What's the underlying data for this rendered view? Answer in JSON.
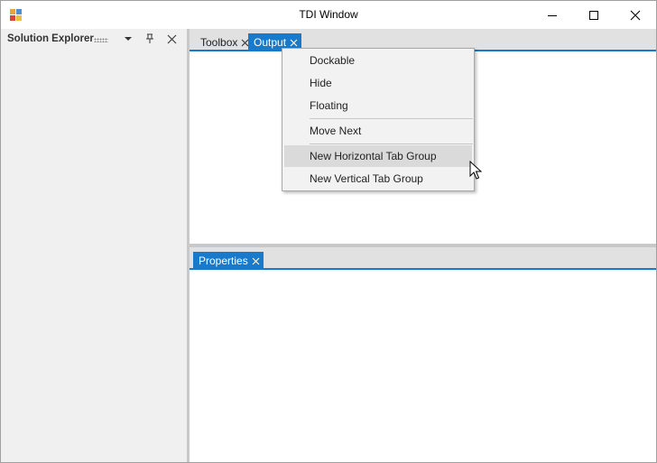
{
  "window": {
    "title": "TDI Window",
    "accent_color": "#1979ca"
  },
  "title_buttons": {
    "minimize_icon": "minimize-icon",
    "maximize_icon": "maximize-icon",
    "close_icon": "close-icon"
  },
  "solution_explorer": {
    "title": "Solution Explorer",
    "icons": [
      "dropdown-arrow-icon",
      "pin-icon",
      "close-icon"
    ]
  },
  "top_tabs": [
    {
      "label": "Toolbox",
      "active": false
    },
    {
      "label": "Output",
      "active": true
    }
  ],
  "bottom_tabs": [
    {
      "label": "Properties",
      "active": true
    }
  ],
  "context_menu": {
    "items": [
      {
        "label": "Dockable"
      },
      {
        "label": "Hide"
      },
      {
        "label": "Floating"
      },
      {
        "label": "Move Next"
      },
      {
        "label": "New Horizontal Tab Group",
        "hovered": true
      },
      {
        "label": "New Vertical Tab Group"
      }
    ]
  }
}
